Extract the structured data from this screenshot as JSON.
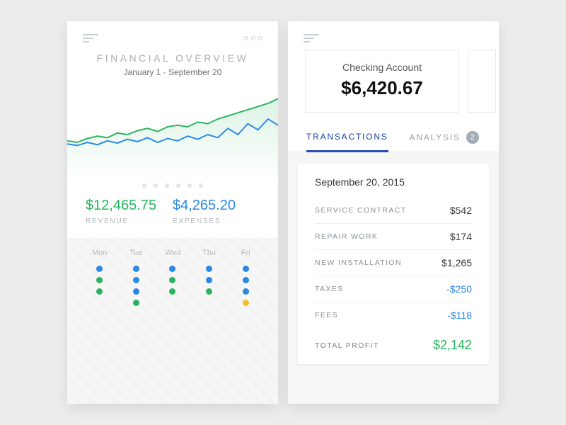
{
  "left": {
    "title": "FINANCIAL OVERVIEW",
    "range": "January 1 - September 20",
    "revenue": {
      "value": "$12,465.75",
      "label": "REVENUE"
    },
    "expenses": {
      "value": "$4,265.20",
      "label": "EXPENSES"
    },
    "days": [
      "Mon",
      "Tue",
      "Wed",
      "Thu",
      "Fri"
    ]
  },
  "right": {
    "account": {
      "name": "Checking Account",
      "balance": "$6,420.67"
    },
    "tabs": {
      "transactions": "TRANSACTIONS",
      "analysis": "ANALYSIS",
      "badge": "2"
    },
    "date": "September 20, 2015",
    "lines": [
      {
        "label": "SERVICE CONTRACT",
        "amount": "$542"
      },
      {
        "label": "REPAIR WORK",
        "amount": "$174"
      },
      {
        "label": "NEW INSTALLATION",
        "amount": "$1,265"
      },
      {
        "label": "TAXES",
        "amount": "-$250",
        "neg": true
      },
      {
        "label": "FEES",
        "amount": "-$118",
        "neg": true
      }
    ],
    "total": {
      "label": "TOTAL PROFIT",
      "amount": "$2,142"
    }
  },
  "chart_data": {
    "type": "line",
    "x_range": "Jan 1 – Sep 20",
    "series": [
      {
        "name": "revenue",
        "color": "#29b55e",
        "values": [
          42,
          40,
          45,
          48,
          46,
          52,
          50,
          55,
          58,
          54,
          60,
          62,
          60,
          66,
          64,
          70,
          74,
          78,
          82,
          86,
          90,
          96
        ]
      },
      {
        "name": "expenses",
        "color": "#2a8ae8",
        "values": [
          38,
          36,
          40,
          37,
          42,
          39,
          44,
          41,
          46,
          40,
          45,
          42,
          48,
          44,
          50,
          46,
          58,
          50,
          64,
          56,
          70,
          62
        ]
      }
    ],
    "ylim": [
      0,
      100
    ],
    "note": "values estimated from plot pixels; no axis ticks shown"
  },
  "dot_chart": {
    "type": "categorical-dot",
    "categories": [
      "Mon",
      "Tue",
      "Wed",
      "Thu",
      "Fri"
    ],
    "columns": [
      [
        "blue",
        "green",
        "green"
      ],
      [
        "blue",
        "blue",
        "blue",
        "green"
      ],
      [
        "blue",
        "green",
        "green"
      ],
      [
        "blue",
        "blue",
        "green"
      ],
      [
        "blue",
        "blue",
        "blue",
        "yellow"
      ]
    ]
  }
}
